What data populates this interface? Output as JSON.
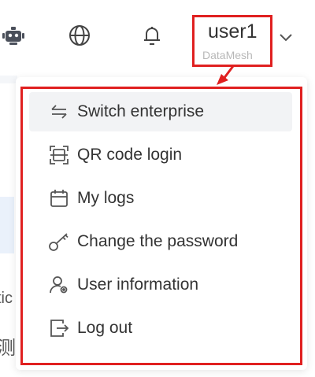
{
  "header": {
    "icons": [
      "robot-icon",
      "globe-icon",
      "bell-icon"
    ],
    "user": {
      "name": "user1",
      "org": "DataMesh"
    }
  },
  "background_text": {
    "line1": "tic",
    "line2": "测"
  },
  "menu": {
    "items": [
      {
        "label": "Switch enterprise",
        "icon": "switch-icon",
        "active": true
      },
      {
        "label": "QR code login",
        "icon": "qr-scan-icon",
        "active": false
      },
      {
        "label": "My logs",
        "icon": "calendar-icon",
        "active": false
      },
      {
        "label": "Change the password",
        "icon": "key-icon",
        "active": false
      },
      {
        "label": "User information",
        "icon": "user-settings-icon",
        "active": false
      },
      {
        "label": "Log out",
        "icon": "logout-icon",
        "active": false
      }
    ]
  },
  "colors": {
    "highlight_border": "#e02020",
    "active_bg": "#f2f3f5",
    "muted_text": "#b8b8b8"
  }
}
